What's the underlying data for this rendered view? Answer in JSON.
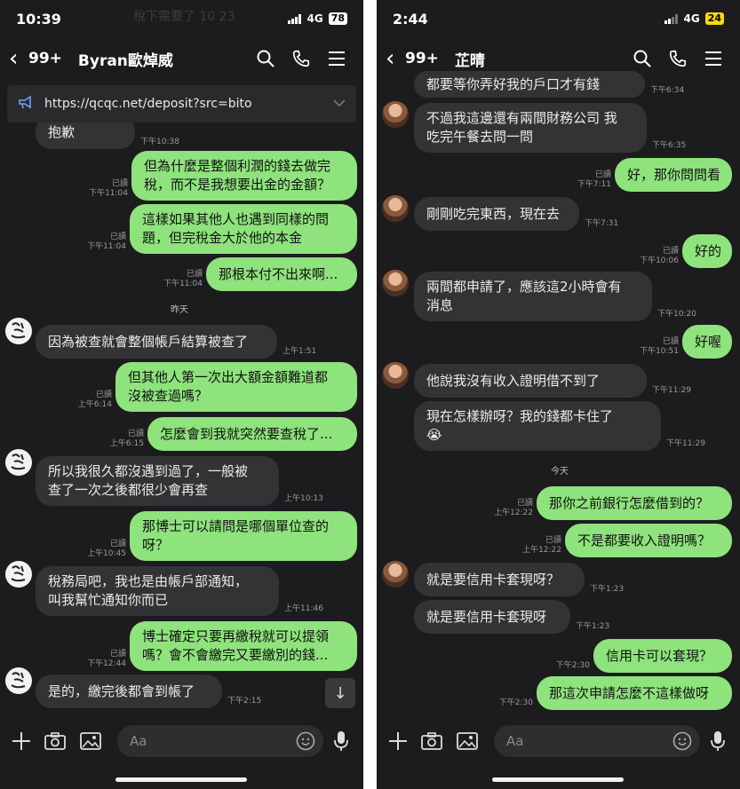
{
  "left": {
    "status": {
      "time": "10:39",
      "network": "4G",
      "battery": "78",
      "battery_color": "#ffffff"
    },
    "header": {
      "back_count": "99+",
      "title": "Byran歐焯威"
    },
    "link_bar": {
      "url": "https://qcqc.net/deposit?src=bito"
    },
    "ghost_text": "稅下需要了 10 23",
    "messages": [
      {
        "dir": "in",
        "lines": [
          "抱歉"
        ],
        "time": "下午10:38"
      },
      {
        "dir": "out",
        "lines": [
          "但為什麼是整個利潤的錢去做完",
          "稅，而不是我想要出金的金額？"
        ],
        "read": "已讀",
        "time": "下午11:04"
      },
      {
        "dir": "out",
        "lines": [
          "這樣如果其他人也遇到同樣的問",
          "題，但完稅金大於他的本金"
        ],
        "read": "已讀",
        "time": "下午11:04"
      },
      {
        "dir": "out",
        "lines": [
          "那根本付不出來啊..."
        ],
        "read": "已讀",
        "time": "下午11:04"
      },
      {
        "dir": "in",
        "lines": [
          "因為被查就會整個帳戶結算被查了"
        ],
        "time": "上午1:51"
      },
      {
        "dir": "out",
        "lines": [
          "但其他人第一次出大額金額難道都",
          "沒被查過嗎？"
        ],
        "read": "已讀",
        "time": "上午6:14"
      },
      {
        "dir": "out",
        "lines": [
          "怎麼會到我就突然要查稅了..."
        ],
        "read": "已讀",
        "time": "上午6:15"
      },
      {
        "dir": "in",
        "lines": [
          "所以我很久都沒遇到過了，一般被",
          "查了一次之後都很少會再查"
        ],
        "time": "上午10:13"
      },
      {
        "dir": "out",
        "lines": [
          "那博士可以請問是哪個單位查的",
          "呀？"
        ],
        "read": "已讀",
        "time": "上午10:45"
      },
      {
        "dir": "in",
        "lines": [
          "稅務局吧，我也是由帳戶部通知，",
          "叫我幫忙通知你而已"
        ],
        "time": "上午11:46"
      },
      {
        "dir": "out",
        "lines": [
          "博士確定只要再繳稅就可以提領",
          "嗎？會不會繳完又要繳別的錢..."
        ],
        "read": "已讀",
        "time": "下午12:44"
      },
      {
        "dir": "in",
        "lines": [
          "是的，繳完後都會到帳了"
        ],
        "time": "下午2:15"
      }
    ],
    "date_separator": "昨天",
    "composer": {
      "placeholder": "Aa"
    }
  },
  "right": {
    "status": {
      "time": "2:44",
      "network": "4G",
      "battery": "24",
      "battery_color": "#f5d90a"
    },
    "header": {
      "back_count": "99+",
      "title": "芷晴"
    },
    "messages": [
      {
        "dir": "in",
        "lines": [
          "都要等你弄好我的戶口才有錢"
        ],
        "time": "下午6:34"
      },
      {
        "dir": "in",
        "lines": [
          "不過我這邊還有兩間財務公司 我",
          "吃完午餐去問一問"
        ],
        "time": "下午6:35"
      },
      {
        "dir": "out",
        "lines": [
          "好，那你問問看"
        ],
        "read": "已讀",
        "time": "下午7:11"
      },
      {
        "dir": "in",
        "lines": [
          "剛剛吃完東西，現在去"
        ],
        "time": "下午7:31"
      },
      {
        "dir": "out",
        "lines": [
          "好的"
        ],
        "read": "已讀",
        "time": "下午10:06"
      },
      {
        "dir": "in",
        "lines": [
          "兩間都申請了，應該這2小時會有",
          "消息"
        ],
        "time": "下午10:20"
      },
      {
        "dir": "out",
        "lines": [
          "好喔"
        ],
        "read": "已讀",
        "time": "下午10:51"
      },
      {
        "dir": "in",
        "lines": [
          "他說我沒有收入證明借不到了"
        ],
        "time": "下午11:29"
      },
      {
        "dir": "in",
        "lines": [
          "現在怎樣辦呀？我的錢都卡住了",
          "😭"
        ],
        "time": "下午11:29"
      },
      {
        "dir": "out",
        "lines": [
          "那你之前銀行怎麼借到的？"
        ],
        "read": "已讀",
        "time": "上午12:22"
      },
      {
        "dir": "out",
        "lines": [
          "不是都要收入證明嗎？"
        ],
        "read": "已讀",
        "time": "上午12:22"
      },
      {
        "dir": "in",
        "lines": [
          "就是要信用卡套現呀？"
        ],
        "time": "下午1:23"
      },
      {
        "dir": "in",
        "lines": [
          "就是要信用卡套現呀"
        ],
        "time": "下午1:23"
      },
      {
        "dir": "out",
        "lines": [
          "信用卡可以套現？"
        ],
        "time": "下午2:30"
      },
      {
        "dir": "out",
        "lines": [
          "那這次申請怎麼不這樣做呀"
        ],
        "time": "下午2:30"
      }
    ],
    "date_separator": "今天",
    "composer": {
      "placeholder": "Aa"
    }
  },
  "colors": {
    "bubble_out": "#8ee37c",
    "bubble_in": "#333335",
    "background": "#1c1c1e"
  },
  "icons": [
    "back-chevron-icon",
    "search-icon",
    "phone-icon",
    "menu-icon",
    "megaphone-icon",
    "chevron-down-icon",
    "plus-icon",
    "camera-icon",
    "image-icon",
    "emoji-icon",
    "mic-icon",
    "arrow-down-icon"
  ]
}
